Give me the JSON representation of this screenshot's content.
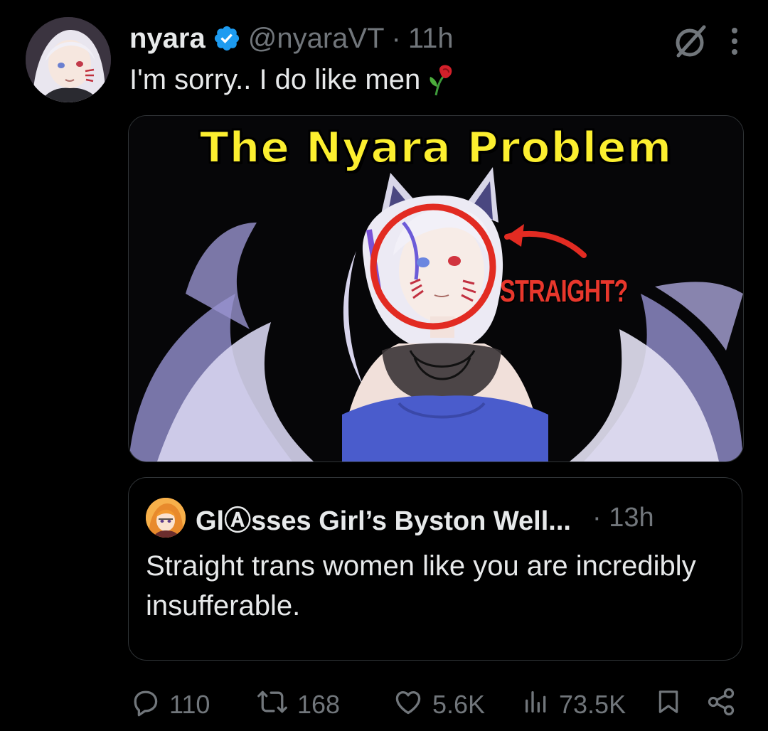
{
  "tweet": {
    "author_name": "nyara",
    "author_handle": "@nyaraVT",
    "separator": "·",
    "time": "11h",
    "text": "I'm sorry.. I do like men",
    "verified": true
  },
  "media": {
    "title": "The Nyara Problem",
    "label": "STRAIGHT?"
  },
  "quote": {
    "author_name": "GlⒶsses Girl’s Byston Well...",
    "separator": "·",
    "time": "13h",
    "text": "Straight trans women like you are incredibly insufferable."
  },
  "actions": {
    "replies": "110",
    "reposts": "168",
    "likes": "5.6K",
    "views": "73.5K"
  },
  "colors": {
    "background": "#000000",
    "text": "#e7e9ea",
    "muted": "#71767b",
    "verified": "#1d9bf0",
    "title_yellow": "#fcef2f",
    "accent_red": "#e8372c"
  },
  "icons": [
    "verified-badge-icon",
    "grok-icon",
    "more-icon",
    "rose-emoji",
    "reply-icon",
    "repost-icon",
    "like-icon",
    "views-icon",
    "bookmark-icon",
    "share-icon"
  ]
}
